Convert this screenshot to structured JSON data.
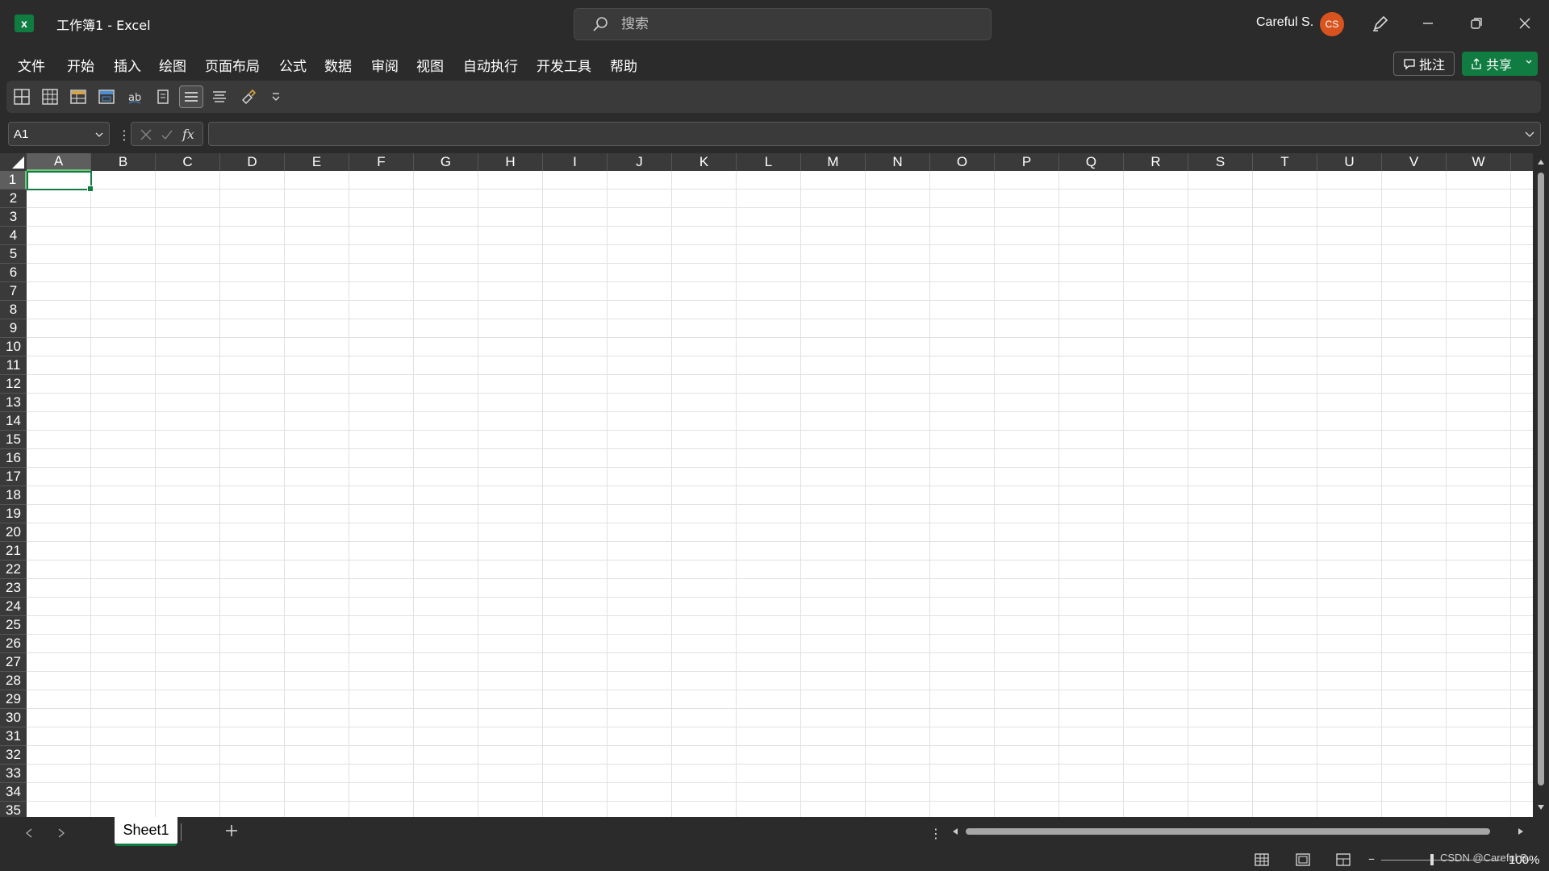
{
  "app": {
    "logo_letter": "x",
    "title": "工作簿1  -  Excel",
    "accent_color": "#107c41"
  },
  "search": {
    "placeholder": "搜索"
  },
  "user": {
    "name": "Careful S.",
    "initials": "CS",
    "avatar_color": "#d9531e"
  },
  "menu": {
    "items": [
      "文件",
      "开始",
      "插入",
      "绘图",
      "页面布局",
      "公式",
      "数据",
      "审阅",
      "视图",
      "自动执行",
      "开发工具",
      "帮助"
    ],
    "comment_label": "批注",
    "share_label": "共享"
  },
  "ribbon": {
    "icons": [
      "borders-all-icon",
      "borders-grid-icon",
      "format-table-icon",
      "cell-styles-icon",
      "phonetic-icon",
      "page-icon",
      "align-center-icon",
      "align-justify-icon",
      "format-painter-icon",
      "customize-toolbar-icon"
    ]
  },
  "formula_bar": {
    "name_box": "A1",
    "value": ""
  },
  "grid": {
    "columns": [
      "A",
      "B",
      "C",
      "D",
      "E",
      "F",
      "G",
      "H",
      "I",
      "J",
      "K",
      "L",
      "M",
      "N",
      "O",
      "P",
      "Q",
      "R",
      "S",
      "T",
      "U",
      "V",
      "W"
    ],
    "rows": [
      "1",
      "2",
      "3",
      "4",
      "5",
      "6",
      "7",
      "8",
      "9",
      "10",
      "11",
      "12",
      "13",
      "14",
      "15",
      "16",
      "17",
      "18",
      "19",
      "20",
      "21",
      "22",
      "23",
      "24",
      "25",
      "26",
      "27",
      "28",
      "29",
      "30",
      "31",
      "32",
      "33",
      "34",
      "35"
    ],
    "selected_column": "A",
    "selected_row": "1"
  },
  "sheets": {
    "tabs": [
      "Sheet1"
    ],
    "active": "Sheet1"
  },
  "status": {
    "zoom": "100%",
    "watermark": "CSDN @Careful S."
  }
}
